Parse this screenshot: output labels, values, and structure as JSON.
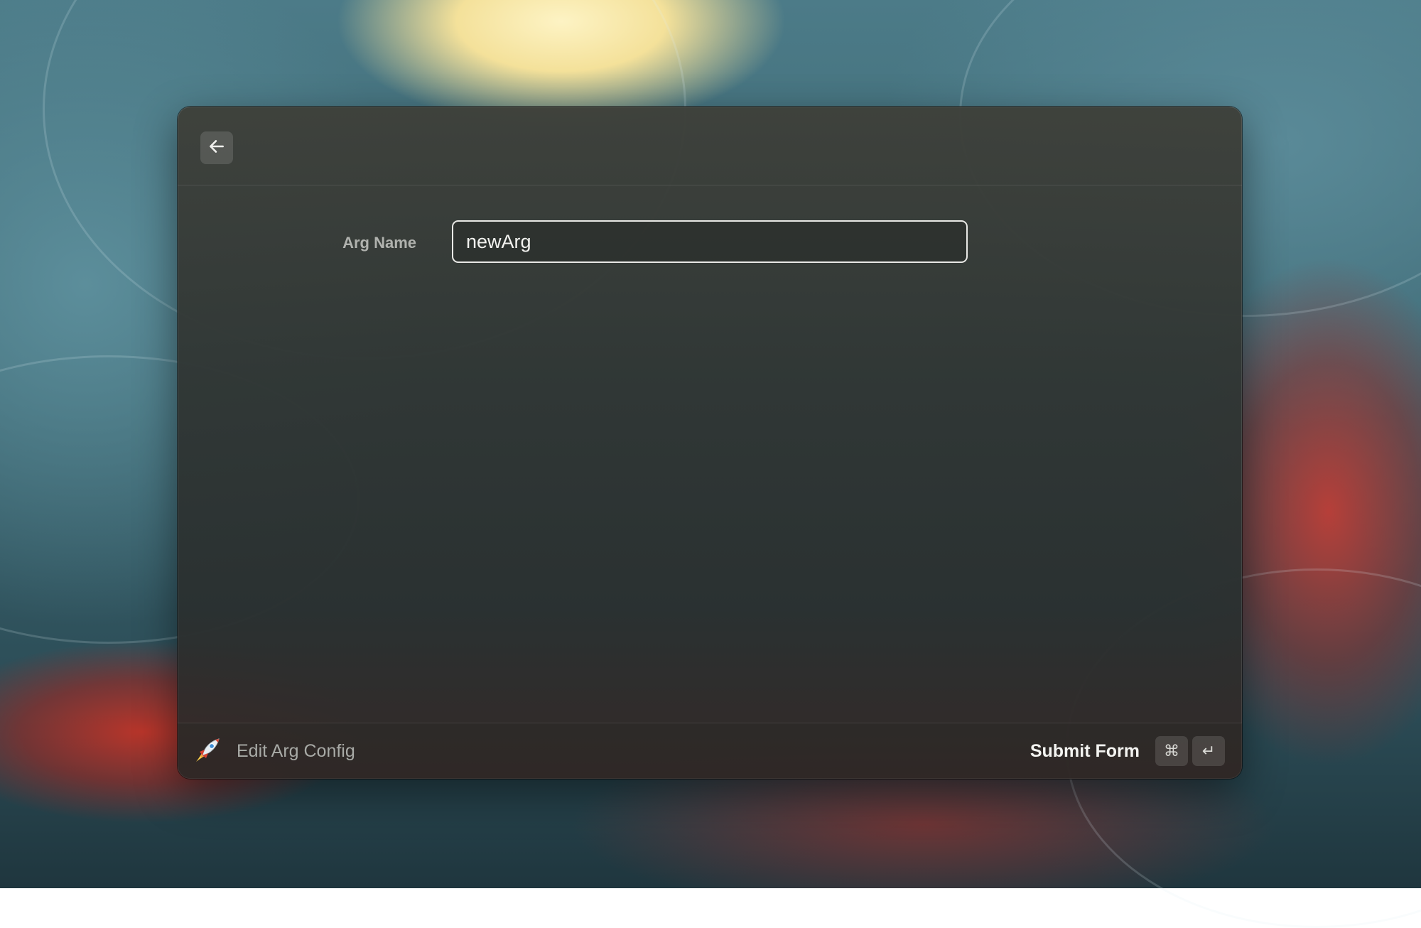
{
  "window": {
    "back_label": "Back"
  },
  "form": {
    "arg_name_label": "Arg Name",
    "arg_name_value": "newArg"
  },
  "footer": {
    "title": "Edit Arg Config",
    "action_label": "Submit Form",
    "shortcut_keys": [
      "⌘",
      "↵"
    ]
  },
  "icons": {
    "back": "arrow-left-icon",
    "app": "rocket-icon",
    "cmd": "command-key-icon",
    "enter": "return-key-icon"
  }
}
